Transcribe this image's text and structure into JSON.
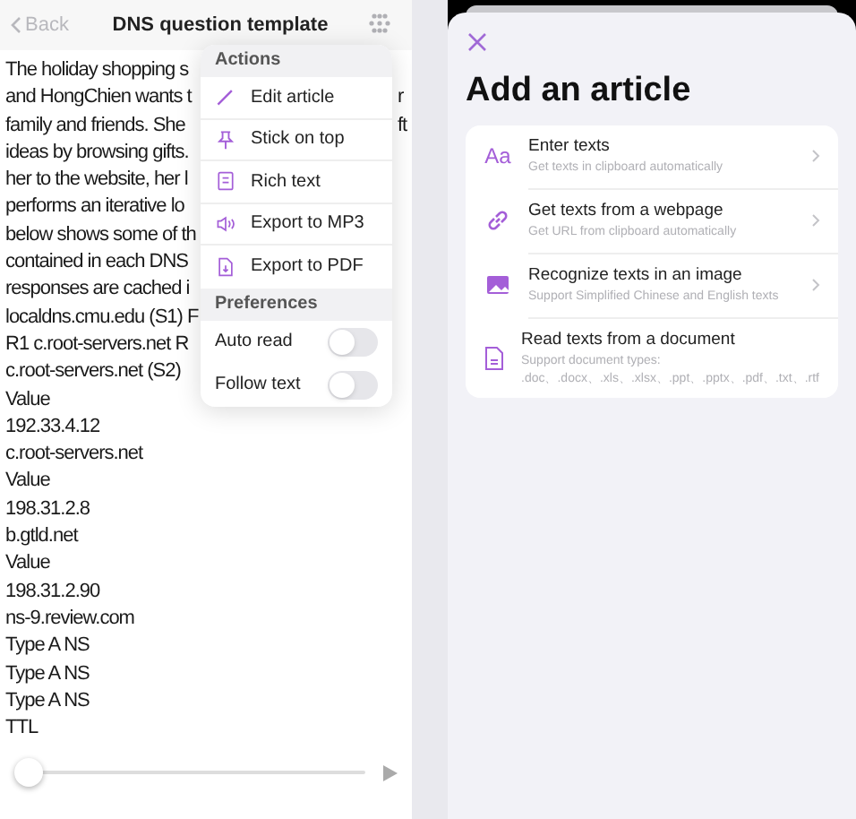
{
  "reader": {
    "back": "Back",
    "title": "DNS question template",
    "lines": [
      {
        "text": "The holiday shopping s"
      },
      {
        "text": "and HongChien wants t",
        "tail": "r"
      },
      {
        "text": "family and friends. She",
        "tail": "ft"
      },
      {
        "text": "ideas by browsing gifts."
      },
      {
        "text": "her to the website, her l"
      },
      {
        "text": "performs an iterative lo"
      },
      {
        "text": "below shows some of th"
      },
      {
        "text": "contained in each DNS"
      },
      {
        "text": "responses are cached i"
      },
      {
        "text": "localdns.cmu.edu (S1) F"
      },
      {
        "text": "R1 c.root-servers.net R"
      },
      {
        "text": "c.root-servers.net (S2)"
      },
      {
        "text": "Value"
      },
      {
        "text": "192.33.4.12"
      },
      {
        "text": "c.root-servers.net"
      },
      {
        "text": "Value"
      },
      {
        "text": "198.31.2.8"
      },
      {
        "text": "b.gtld.net"
      },
      {
        "text": "Value"
      },
      {
        "text": "198.31.2.90"
      },
      {
        "text": "ns-9.review.com"
      },
      {
        "text": "Type A NS"
      },
      {
        "text": "Type A NS"
      },
      {
        "text": "Type A NS"
      },
      {
        "text": "TTL"
      }
    ],
    "player": {
      "level": 0
    },
    "menu": {
      "actions_header": "Actions",
      "actions": [
        {
          "kind": "pen",
          "label": "Edit article"
        },
        {
          "kind": "pin",
          "label": "Stick on top"
        },
        {
          "kind": "rich",
          "label": "Rich text"
        },
        {
          "kind": "speaker",
          "label": "Export to MP3"
        },
        {
          "kind": "pdf",
          "label": "Export to PDF"
        }
      ],
      "preferences_header": "Preferences",
      "preferences": [
        {
          "label": "Auto read",
          "on": false
        },
        {
          "label": "Follow text",
          "on": false
        }
      ]
    }
  },
  "add_article": {
    "title": "Add an article",
    "options": [
      {
        "kind": "text",
        "icon_text": "Aa",
        "title": "Enter texts",
        "subtitle": "Get texts in clipboard automatically"
      },
      {
        "kind": "link",
        "title": "Get texts from a webpage",
        "subtitle": "Get URL from clipboard automatically"
      },
      {
        "kind": "image",
        "title": "Recognize texts in an image",
        "subtitle": "Support Simplified Chinese and English texts"
      },
      {
        "kind": "document",
        "title": "Read texts from a document",
        "subtitle": "Support document types: .doc、.docx、.xls、.xlsx、.ppt、.pptx、.pdf、.txt、.rtf"
      }
    ]
  }
}
